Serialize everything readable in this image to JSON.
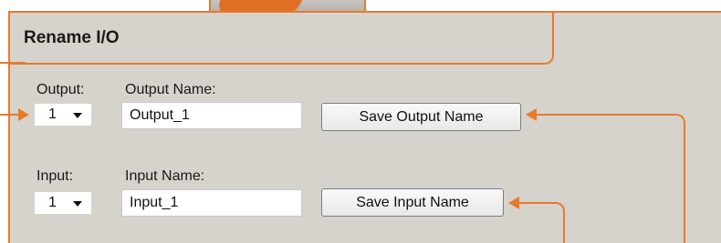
{
  "section": {
    "title": "Rename I/O"
  },
  "output": {
    "label": "Output:",
    "selected": "1",
    "name_label": "Output Name:",
    "name_value": "Output_1",
    "save_label": "Save Output Name"
  },
  "input": {
    "label": "Input:",
    "selected": "1",
    "name_label": "Input Name:",
    "name_value": "Input_1",
    "save_label": "Save Input Name"
  },
  "colors": {
    "callout": "#e87a2c",
    "panel": "#d6d3cd"
  }
}
